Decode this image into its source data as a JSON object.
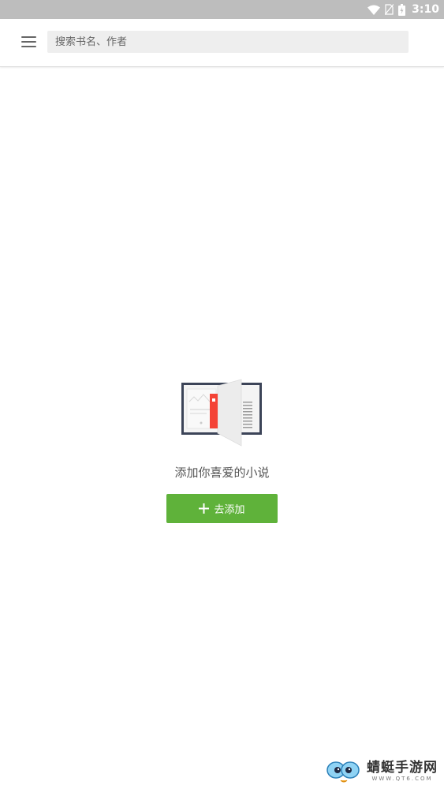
{
  "status_bar": {
    "time": "3:10",
    "icons": [
      "wifi-icon",
      "no-sim-icon",
      "battery-icon"
    ]
  },
  "header": {
    "menu_icon": "hamburger-menu-icon",
    "search": {
      "placeholder": "搜索书名、作者",
      "value": ""
    }
  },
  "empty_state": {
    "illustration": "open-book-icon",
    "message": "添加你喜爱的小说",
    "button_label": "去添加",
    "button_icon": "plus-icon"
  },
  "watermark": {
    "name": "蜻蜓手游网",
    "site": "WWW.QT6.COM"
  },
  "colors": {
    "status_bar": "#bdbdbd",
    "accent_green": "#5fb23a",
    "bookmark_red": "#f44336",
    "search_bg": "#eeeeee"
  }
}
